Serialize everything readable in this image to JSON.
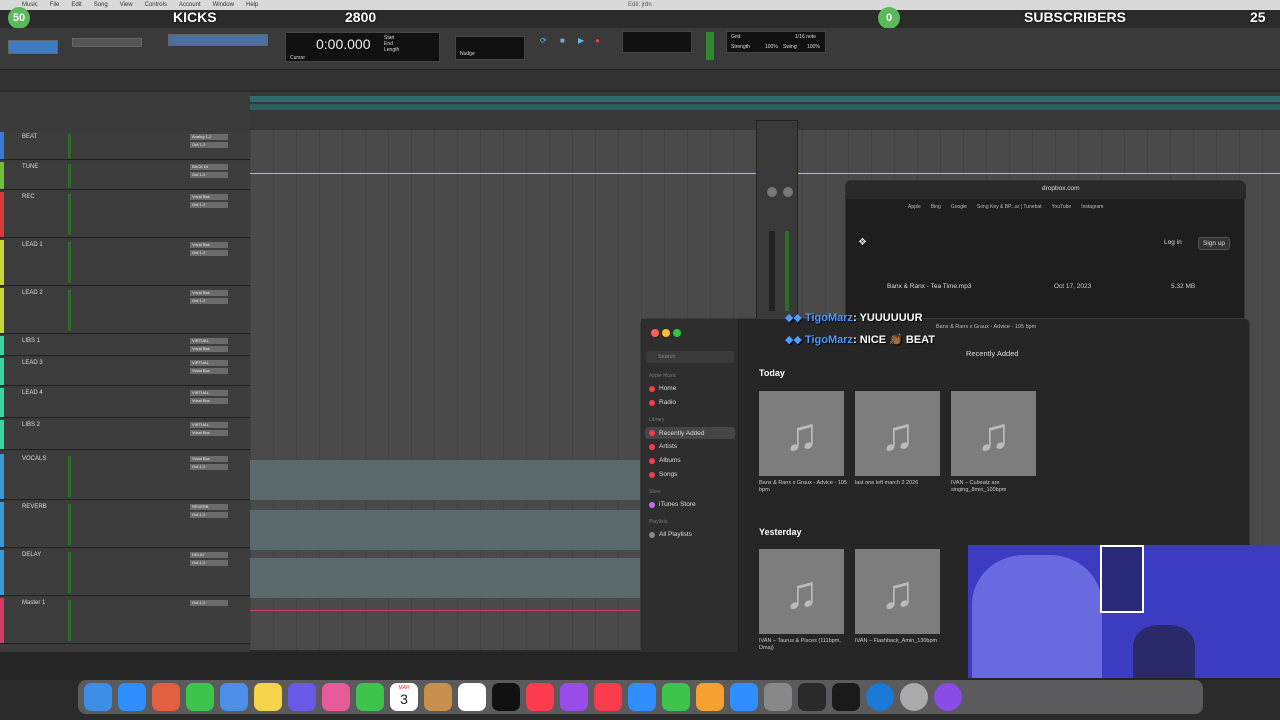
{
  "menubar": {
    "items": [
      "Music",
      "File",
      "Edit",
      "Song",
      "View",
      "Controls",
      "Account",
      "Window",
      "Help"
    ],
    "window_title": "Edit: jrdn"
  },
  "overlay": {
    "left_count": "50",
    "left_label": "KICKS",
    "left_value": "2800",
    "right_count": "0",
    "right_label": "SUBSCRIBERS",
    "right_value": "25"
  },
  "toolbar": {
    "counter": "0:00.000",
    "cursor_label": "Cursor",
    "start_label": "Start",
    "end_label": "End",
    "length_label": "Length",
    "grid_label": "Grid",
    "nudge_label": "Nudge",
    "grid_value": "1/16 note",
    "strength_label": "Strength",
    "strength_value": "100%",
    "swing_label": "Swing",
    "swing_value": "100%"
  },
  "tracks": [
    {
      "name": "BEAT",
      "color": "#3a7ad6",
      "io": "Analog 1-2",
      "io2": "Out 1-2"
    },
    {
      "name": "TUNE",
      "color": "#6fbf3a",
      "io": "BACK IN",
      "io2": "Out 1-2"
    },
    {
      "name": "REC",
      "color": "#d63a3a",
      "io": "Vocal Bus",
      "io2": "Out 1-2"
    },
    {
      "name": "LEAD 1",
      "color": "#c9d63a",
      "io": "Vocal Bus",
      "io2": "Out 1-2"
    },
    {
      "name": "LEAD 2",
      "color": "#c9d63a",
      "io": "Vocal Bus",
      "io2": "Out 1-2"
    },
    {
      "name": "LIBS 1",
      "color": "#3ad6a0",
      "io": "VIRTUAL",
      "io2": "Vocal Bus"
    },
    {
      "name": "LEAD 3",
      "color": "#3ad6a0",
      "io": "VIRTUAL",
      "io2": "Vocal Bus"
    },
    {
      "name": "LEAD 4",
      "color": "#3ad6a0",
      "io": "VIRTUAL",
      "io2": "Vocal Bus"
    },
    {
      "name": "LIBS 2",
      "color": "#3ad6a0",
      "io": "VIRTUAL",
      "io2": "Vocal Bus"
    },
    {
      "name": "VOCALS",
      "color": "#3a9ad6",
      "io": "Vocal Bus",
      "io2": "Out 1-2"
    },
    {
      "name": "REVERB",
      "color": "#3a9ad6",
      "io": "REVERB",
      "io2": "Out 1-2"
    },
    {
      "name": "DELAY",
      "color": "#3a9ad6",
      "io": "DELAY",
      "io2": "Out 1-2"
    },
    {
      "name": "Master 1",
      "color": "#d63a6a",
      "io": "Out 1-2",
      "io2": ""
    }
  ],
  "browser": {
    "url": "dropbox.com",
    "bookmarks": [
      "Apple",
      "Bing",
      "Google",
      "Song Key & BP...ar | Tunebat",
      "YouTube",
      "Instagram"
    ],
    "login": "Log in",
    "signup": "Sign up",
    "file_name": "Banx & Ranx - Tea Time.mp3",
    "file_date": "Oct 17, 2023",
    "file_size": "5.32 MB"
  },
  "chat": [
    {
      "user": "TigoMarz",
      "msg": ": YUUUUUUR"
    },
    {
      "user": "TigoMarz",
      "msg": ": NICE 👏🏾 BEAT"
    }
  ],
  "music": {
    "now_playing": "Banx & Ranx x Graux - Advice - 105 bpm",
    "search_placeholder": "Search",
    "apple_music": "Apple Music",
    "home": "Home",
    "radio": "Radio",
    "library": "Library",
    "recently_added": "Recently Added",
    "artists": "Artists",
    "albums": "Albums",
    "songs": "Songs",
    "store": "Store",
    "itunes_store": "iTunes Store",
    "playlists": "Playlists",
    "all_playlists": "All Playlists",
    "header": "Recently Added",
    "today": "Today",
    "yesterday": "Yesterday",
    "today_items": [
      "Banx & Ranx x Graux - Advice - 105 bpm",
      "last one left march 2 2026",
      "IVAN – Cubeatz are singing_8min_100bpm"
    ],
    "yesterday_items": [
      "IVAN – Taurus & Pisces (111bpm, Dmaj)",
      "IVAN – Flashback_Amin_130bpm"
    ]
  },
  "dock": {
    "calendar_month": "MAR",
    "calendar_day": "3"
  }
}
